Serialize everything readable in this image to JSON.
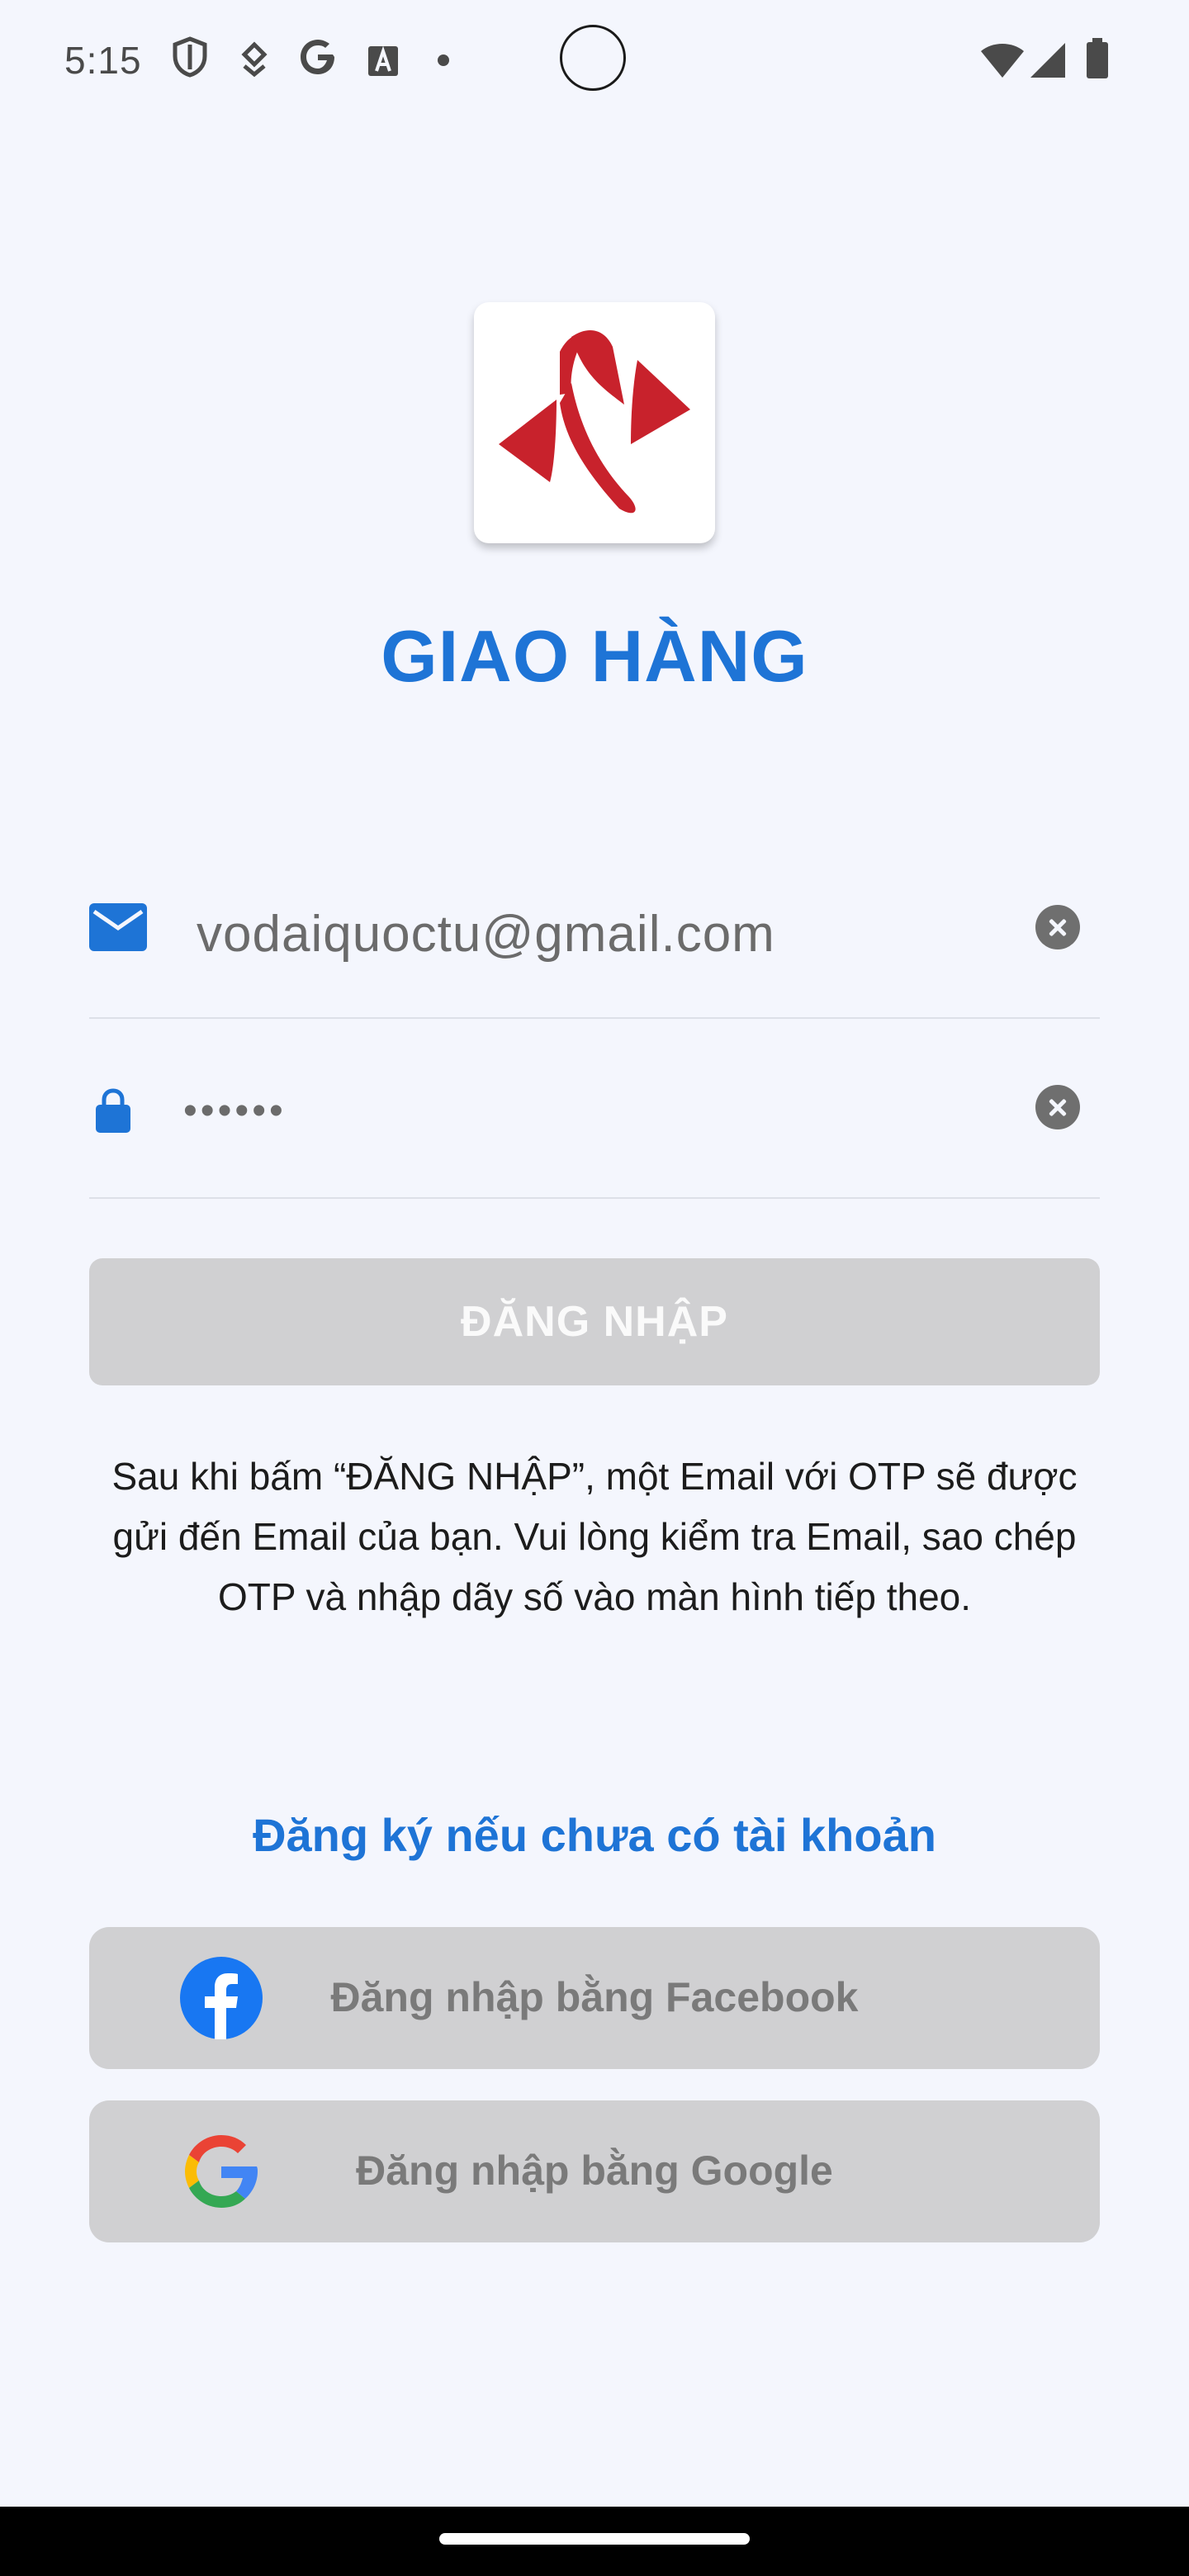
{
  "status_bar": {
    "time": "5:15",
    "icons": [
      "shield-icon",
      "location-icon",
      "google-icon",
      "font-icon",
      "wifi-icon",
      "signal-icon",
      "battery-icon"
    ]
  },
  "app": {
    "title": "GIAO HÀNG",
    "brand_color": "#1e74d6",
    "logo_color": "#c8222c"
  },
  "form": {
    "email_value": "vodaiquoctu@gmail.com",
    "password_value": "••••••",
    "login_label": "ĐĂNG NHẬP"
  },
  "info_text": "Sau khi bấm “ĐĂNG NHẬP”, một Email với OTP sẽ được gửi đến Email của bạn. Vui lòng kiểm tra Email, sao chép OTP và nhập dãy số vào màn hình tiếp theo.",
  "register_link": "Đăng ký nếu chưa có tài khoản",
  "social": {
    "facebook_label": "Đăng nhập bằng Facebook",
    "google_label": "Đăng nhập bằng Google"
  }
}
